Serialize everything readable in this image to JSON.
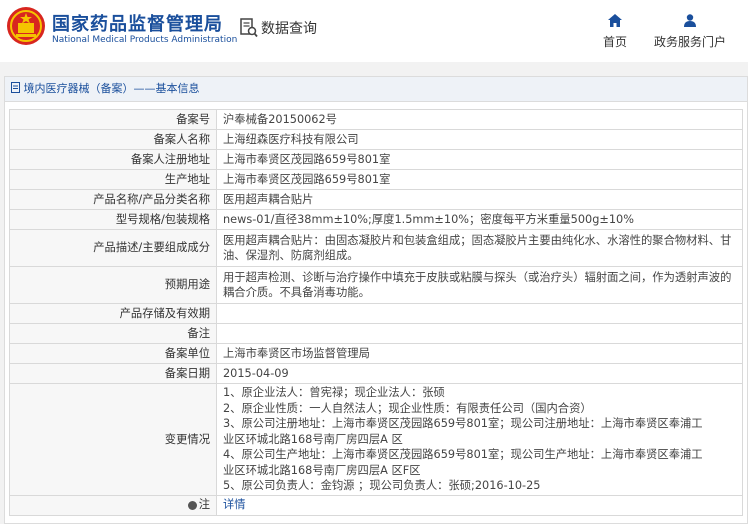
{
  "header": {
    "org_name_cn": "国家药品监督管理局",
    "org_name_en": "National Medical Products Administration",
    "search_label": "数据查询",
    "nav": [
      {
        "label": "首页",
        "icon": "home-icon"
      },
      {
        "label": "政务服务门户",
        "icon": "user-icon"
      }
    ]
  },
  "breadcrumb": {
    "section": "境内医疗器械（备案）",
    "separator": "——",
    "current": "基本信息"
  },
  "record": {
    "fields": [
      {
        "label": "备案号",
        "value": "沪奉械备20150062号"
      },
      {
        "label": "备案人名称",
        "value": "上海纽森医疗科技有限公司"
      },
      {
        "label": "备案人注册地址",
        "value": "上海市奉贤区茂园路659号801室"
      },
      {
        "label": "生产地址",
        "value": "上海市奉贤区茂园路659号801室"
      },
      {
        "label": "产品名称/产品分类名称",
        "value": "医用超声耦合贴片"
      },
      {
        "label": "型号规格/包装规格",
        "value": "news-01/直径38mm±10%;厚度1.5mm±10%；密度每平方米重量500g±10%"
      },
      {
        "label": "产品描述/主要组成成分",
        "value": "医用超声耦合贴片：由固态凝胶片和包装盒组成；固态凝胶片主要由纯化水、水溶性的聚合物材料、甘油、保湿剂、防腐剂组成。"
      },
      {
        "label": "预期用途",
        "value": "用于超声检测、诊断与治疗操作中填充于皮肤或粘膜与探头（或治疗头）辐射面之间，作为透射声波的耦合介质。不具备消毒功能。"
      },
      {
        "label": "产品存储及有效期",
        "value": ""
      },
      {
        "label": "备注",
        "value": ""
      },
      {
        "label": "备案单位",
        "value": "上海市奉贤区市场监督管理局"
      },
      {
        "label": "备案日期",
        "value": "2015-04-09"
      }
    ],
    "changes_label": "变更情况",
    "changes": [
      "1、原企业法人：曾宪禄；现企业法人：张硕",
      "2、原企业性质：一人自然法人；现企业性质：有限责任公司（国内合资）",
      "3、原公司注册地址：上海市奉贤区茂园路659号801室；现公司注册地址：上海市奉贤区奉浦工",
      "业区环城北路168号南厂房四层A 区",
      "4、原公司生产地址：上海市奉贤区茂园路659号801室；现公司生产地址：上海市奉贤区奉浦工",
      "业区环城北路168号南厂房四层A 区F区",
      "5、原公司负责人：金钧源 ；现公司负责人：张硕;2016-10-25"
    ],
    "note_label": "注",
    "note_link": "详情"
  }
}
